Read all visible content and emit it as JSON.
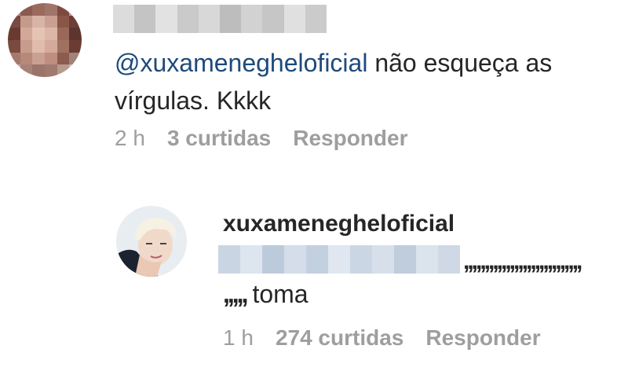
{
  "comment": {
    "mention": "@xuxameneghelo​ficial",
    "text": " não esqueça as vírgulas. Kkkk",
    "time": "2 h",
    "likes": "3 curtidas",
    "reply_label": "Responder"
  },
  "reply": {
    "username": "xuxameneghelo​ficial",
    "trailing_commas": ",,,,,,,,,,,,,,,,,,,,,,,,,,,,",
    "lead_commas": ",,,,,",
    "text": "toma",
    "time": "1 h",
    "likes": "274 curtidas",
    "reply_label": "Responder"
  },
  "colors": {
    "mention": "#1e4a7a",
    "meta_text": "#9e9e9e",
    "body_text": "#262626"
  }
}
